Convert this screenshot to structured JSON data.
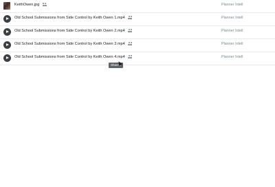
{
  "files": [
    {
      "name": "KeithOwen.jpg",
      "owner": "Planner Intell",
      "type": "image"
    },
    {
      "name": "Old School Submissions from Side Control by Keith Owen 1.mp4",
      "owner": "Planner Intell",
      "type": "video"
    },
    {
      "name": "Old School Submissions from Side Control by Keith Owen 2.mp4",
      "owner": "Planner Intell",
      "type": "video"
    },
    {
      "name": "Old School Submissions from Side Control by Keith Owen 3.mp4",
      "owner": "Planner Intell",
      "type": "video"
    },
    {
      "name": "Old School Submissions from Side Control by Keith Owen 4.mp4",
      "owner": "Planner Intell",
      "type": "video"
    }
  ],
  "tooltip": "Shared"
}
